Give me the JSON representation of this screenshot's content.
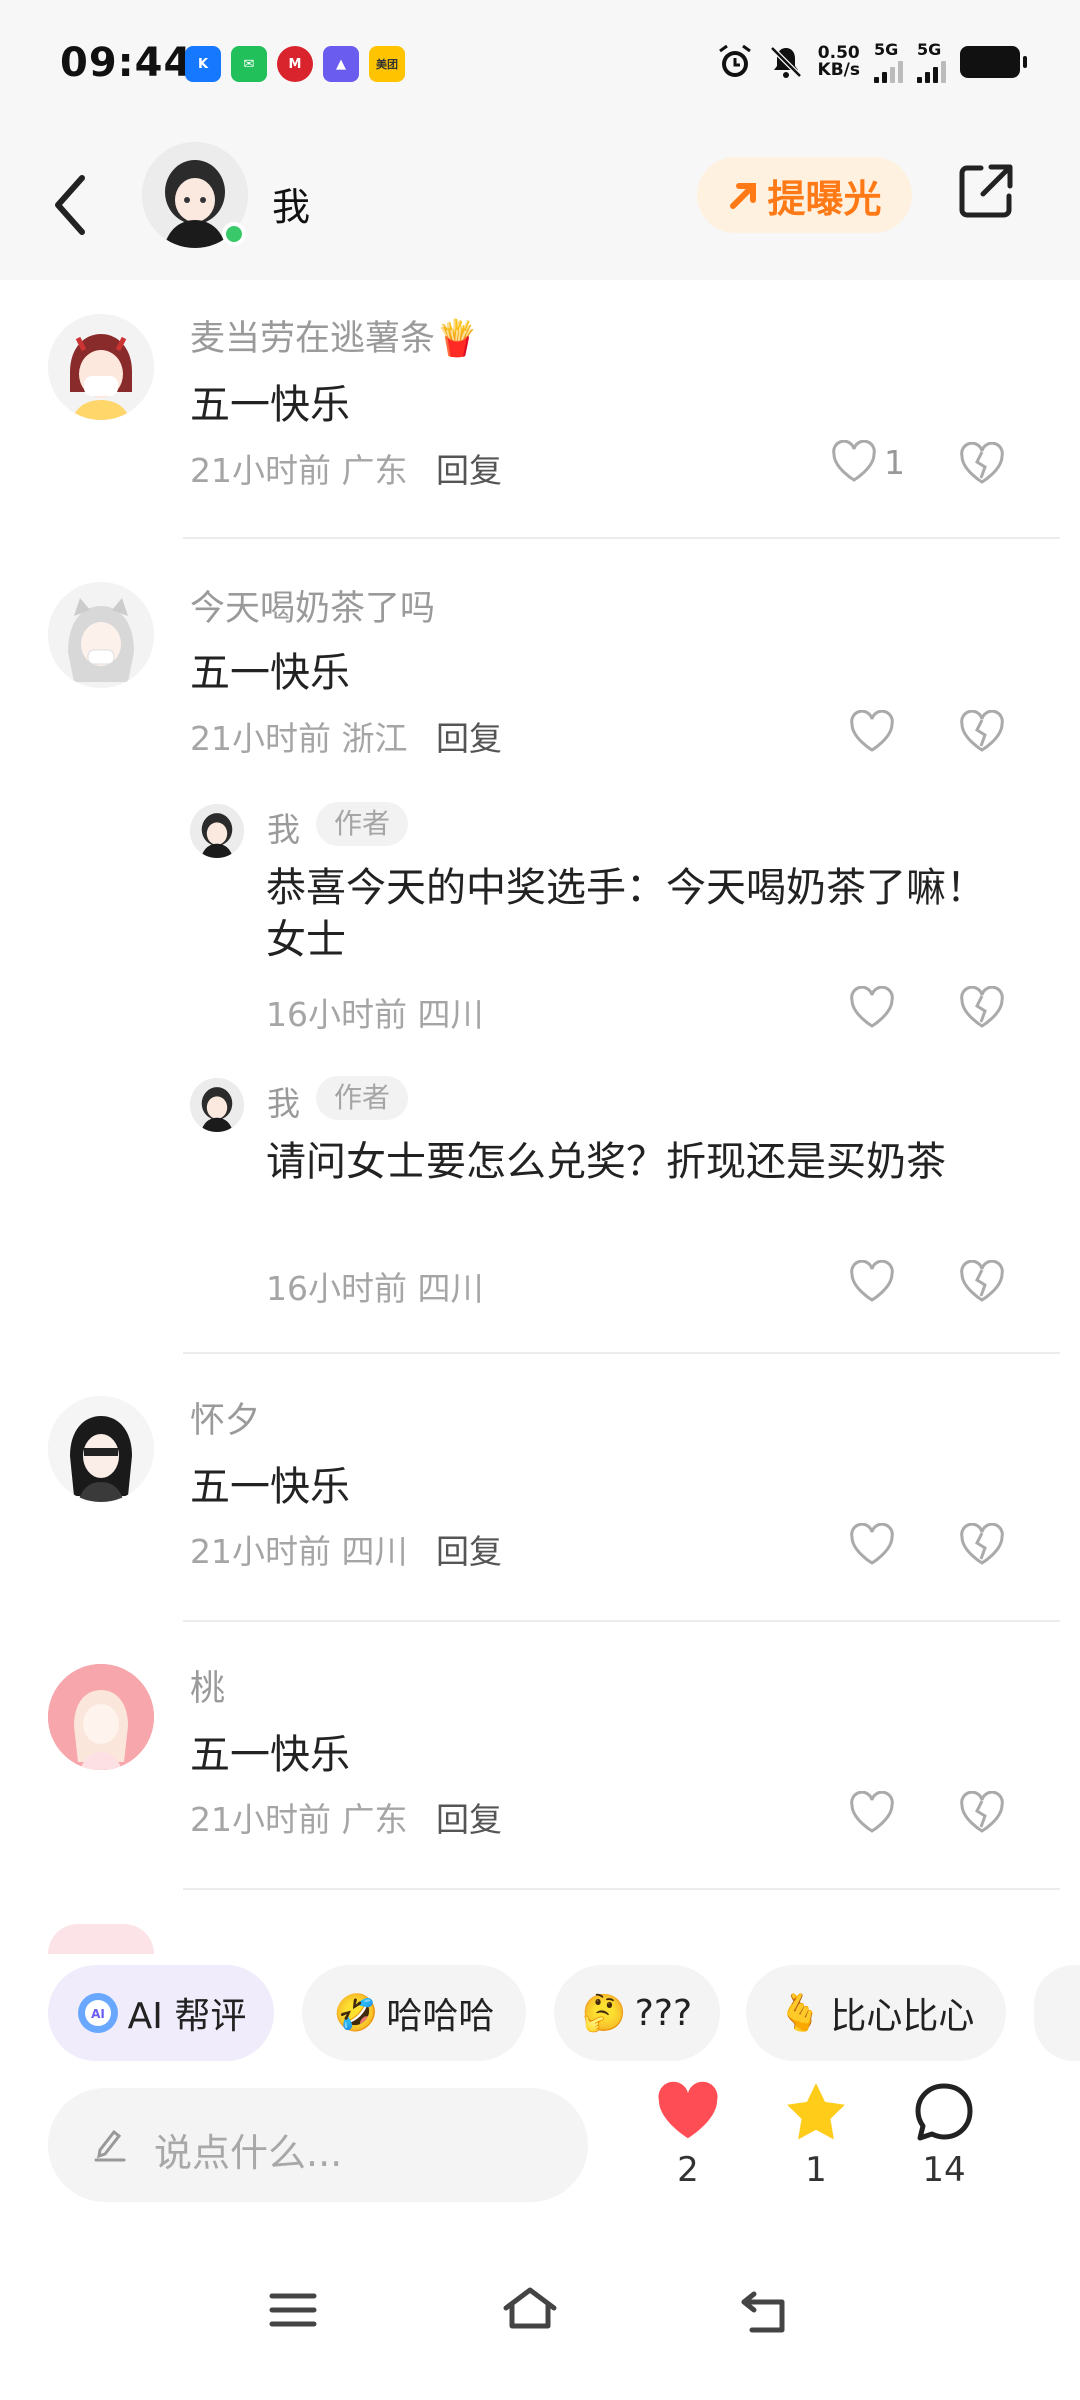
{
  "status_bar": {
    "time": "09:44",
    "net_speed": "0.50",
    "net_unit": "KB/s",
    "sim1": "5G",
    "sim2": "5G",
    "meituan_label": "美团"
  },
  "header": {
    "title": "我",
    "boost_label": "提曝光",
    "colors": {
      "accent": "#ff7a16",
      "online": "#39c96a"
    }
  },
  "comments": [
    {
      "user": "麦当劳在逃薯条🍟",
      "text": "五一快乐",
      "time": "21小时前",
      "region": "广东",
      "reply_label": "回复",
      "likes": "1"
    },
    {
      "user": "今天喝奶茶了吗",
      "text": "五一快乐",
      "time": "21小时前",
      "region": "浙江",
      "reply_label": "回复",
      "likes": "",
      "replies": [
        {
          "user": "我",
          "tag": "作者",
          "text": "恭喜今天的中奖选手：今天喝奶茶了嘛！女士",
          "time": "16小时前",
          "region": "四川"
        },
        {
          "user": "我",
          "tag": "作者",
          "text": "请问女士要怎么兑奖？折现还是买奶茶",
          "time": "16小时前",
          "region": "四川"
        }
      ]
    },
    {
      "user": "怀夕",
      "text": "五一快乐",
      "time": "21小时前",
      "region": "四川",
      "reply_label": "回复",
      "likes": ""
    },
    {
      "user": "桃",
      "text": "五一快乐",
      "time": "21小时前",
      "region": "广东",
      "reply_label": "回复",
      "likes": ""
    }
  ],
  "quick_chips": [
    "AI 帮评",
    "哈哈哈",
    "???",
    "比心比心"
  ],
  "chip_emojis": [
    "",
    "🤣",
    "🤔",
    "🫰"
  ],
  "input": {
    "placeholder": "说点什么..."
  },
  "actions": {
    "likes": "2",
    "stars": "1",
    "comments": "14"
  },
  "icons": [
    "back-icon",
    "share-icon",
    "heart-outline-icon",
    "broken-heart-icon",
    "heart-filled-icon",
    "star-icon",
    "comment-icon",
    "pencil-icon",
    "menu-icon",
    "home-icon",
    "return-icon"
  ]
}
